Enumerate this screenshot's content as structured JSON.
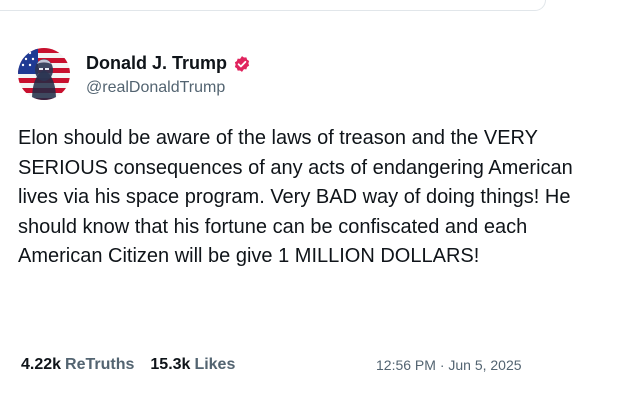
{
  "post": {
    "author": {
      "display_name": "Donald J. Trump",
      "handle": "@realDonaldTrump",
      "verified": true,
      "verified_color": "#e0245e",
      "avatar": "flag-portrait-avatar"
    },
    "text": "Elon should be aware of the laws of treason and the VERY SERIOUS consequences of any acts of endangering American lives via his space program. Very BAD way of doing things! He should know that his fortune can be confiscated and each American Citizen will be give 1 MILLION DOLLARS!",
    "stats": {
      "retruths_count": "4.22k",
      "retruths_label": "ReTruths",
      "likes_count": "15.3k",
      "likes_label": "Likes"
    },
    "timestamp": "12:56 PM · Jun 5, 2025"
  },
  "colors": {
    "text_primary": "#0f1419",
    "text_secondary": "#536471",
    "badge": "#e0245e"
  }
}
